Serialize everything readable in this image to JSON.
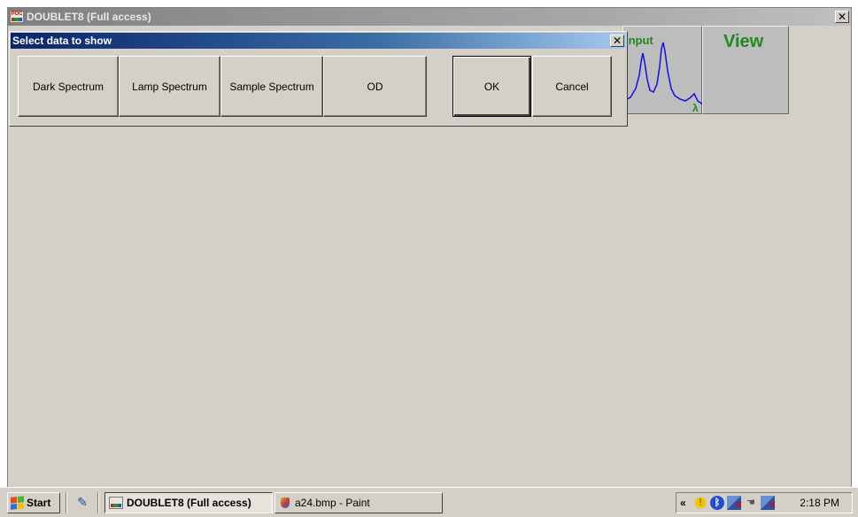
{
  "app_window": {
    "title": "DOUBLET8 (Full access)",
    "icon_label": "POC",
    "icon": "app-doublet-icon"
  },
  "toolbar": {
    "input_label": "Input",
    "view_label": "View",
    "lambda_symbol": "λ"
  },
  "dialog": {
    "title": "Select data to show",
    "buttons": {
      "dark_spectrum": "Dark Spectrum",
      "lamp_spectrum": "Lamp Spectrum",
      "sample_spectrum": "Sample Spectrum",
      "od": "OD",
      "ok": "OK",
      "cancel": "Cancel"
    }
  },
  "taskbar": {
    "start_label": "Start",
    "tasks": [
      {
        "label": "DOUBLET8 (Full access)",
        "active": true,
        "icon": "doublet-icon"
      },
      {
        "label": "a24.bmp - Paint",
        "active": false,
        "icon": "paint-icon"
      }
    ],
    "tray": {
      "chevron": "«",
      "icons": [
        "security-shield-icon",
        "bluetooth-icon",
        "network-disconnected-icon",
        "safely-remove-hardware-icon",
        "network-disconnected-icon"
      ],
      "clock": "2:18 PM"
    }
  },
  "colors": {
    "accent_green": "#1e8a1e",
    "spectrum_blue": "#1010e0",
    "dialog_title_start": "#0a246a",
    "dialog_title_end": "#a6caf0"
  }
}
